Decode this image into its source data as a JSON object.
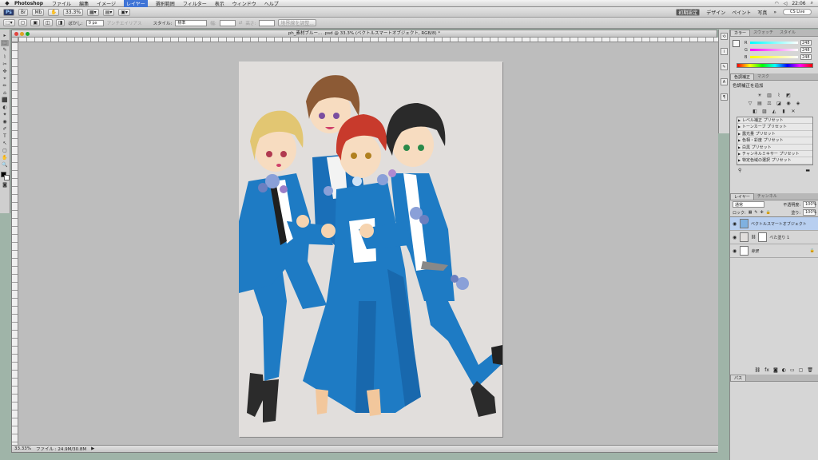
{
  "menubar": {
    "apple": "",
    "app": "Photoshop",
    "items": [
      "ファイル",
      "編集",
      "イメージ",
      "レイヤー",
      "選択範囲",
      "フィルター",
      "表示",
      "ウィンドウ",
      "ヘルプ"
    ],
    "active_index": 3,
    "clock": "22:06",
    "user": "CS5 Live"
  },
  "appbar": {
    "zoom": "33.3%",
    "workspaces": [
      "初期設定",
      "デザイン",
      "ペイント",
      "写真"
    ],
    "active_workspace": 0,
    "cs_live": "CS Live"
  },
  "options": {
    "feather_label": "ぼかし:",
    "feather_value": "0 px",
    "antialias_label": "アンチエイリアス",
    "style_label": "スタイル:",
    "style_value": "標準",
    "width_label": "幅:",
    "height_label": "高さ:",
    "refine_label": "境界線を調整..."
  },
  "tools": [
    "▸",
    "⬚",
    "✎",
    "⌇",
    "✂",
    "✜",
    "⌖",
    "✏",
    "⌂",
    "⬛",
    "◐",
    "✦",
    "◉",
    "✐",
    "T",
    "↖",
    "▢",
    "✋",
    "🔍"
  ],
  "document": {
    "title": "ph_素材ブルー... .psd @ 33.3% (ベクトルスマートオブジェクト, RGB/8) *",
    "status_zoom": "33.33%",
    "status_file": "ファイル : 24.9M/30.8M"
  },
  "color_panel": {
    "tabs": [
      "カラー",
      "スウォッチ",
      "スタイル"
    ],
    "channels": [
      {
        "name": "R",
        "value": "248"
      },
      {
        "name": "G",
        "value": "248"
      },
      {
        "name": "B",
        "value": "248"
      }
    ]
  },
  "adjust_panel": {
    "tabs": [
      "色調補正",
      "マスク"
    ],
    "title": "色調補正を追加",
    "presets": [
      "レベル補正 プリセット",
      "トーンカーブ プリセット",
      "露光量 プリセット",
      "色相・彩度 プリセット",
      "白黒 プリセット",
      "チャンネルミキサー プリセット",
      "特定色域の選択 プリセット"
    ]
  },
  "layers_panel": {
    "tabs": [
      "レイヤー",
      "チャンネル"
    ],
    "blend_mode": "通常",
    "opacity_label": "不透明度:",
    "opacity": "100%",
    "lock_label": "ロック:",
    "fill_label": "塗り:",
    "fill": "100%",
    "layers": [
      {
        "name": "ベクトルスマートオブジェクト",
        "selected": true
      },
      {
        "name": "べた塗り 1",
        "selected": false
      },
      {
        "name": "背景",
        "selected": false
      }
    ]
  },
  "paths_panel": {
    "tab": "パス"
  },
  "colors": {
    "accent": "#3f74d6",
    "canvas_bg": "#e1dedc",
    "suit_blue": "#1e7bc4"
  }
}
